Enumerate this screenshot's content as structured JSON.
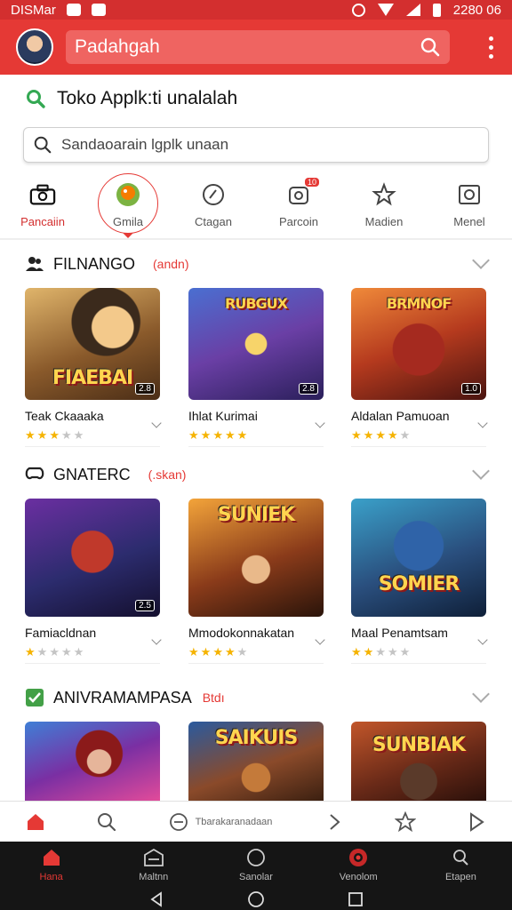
{
  "status_bar": {
    "left_text": "DISMar",
    "time": "2280 06"
  },
  "app_bar": {
    "search_value": "Padahgah"
  },
  "store": {
    "title": "Toko Applk:ti unalalah",
    "search_placeholder": "Sandaoarain lgplk unaan"
  },
  "categories": [
    {
      "label": "Pancaiin",
      "icon": "camera-bag-icon"
    },
    {
      "label": "Gmila",
      "icon": "game-avatar-icon"
    },
    {
      "label": "Ctagan",
      "icon": "compass-icon"
    },
    {
      "label": "Parcoin",
      "icon": "notification-icon",
      "badge": "10"
    },
    {
      "label": "Madien",
      "icon": "star-outline-icon"
    },
    {
      "label": "Menel",
      "icon": "image-icon"
    }
  ],
  "sections": [
    {
      "title": "FILNANGO",
      "subtitle": "(andn)",
      "icon": "people-icon",
      "apps": [
        {
          "name": "Teak Ckaaaka",
          "art_title": "FIAEBAI",
          "tag": "2.8",
          "rating": 3
        },
        {
          "name": "Ihlat Kurimai",
          "art_title": "RUBGUX",
          "tag": "2.8",
          "rating": 5
        },
        {
          "name": "Aldalan Pamuoan",
          "art_title": "BRMNOF",
          "tag": "1.0",
          "rating": 4
        }
      ]
    },
    {
      "title": "GNATERC",
      "subtitle": "(.skan)",
      "icon": "gamepad-icon",
      "apps": [
        {
          "name": "Famiacldnan",
          "art_title": "",
          "tag": "2.5",
          "rating": 1
        },
        {
          "name": "Mmodokonnakatan",
          "art_title": "SUNIEK",
          "tag": "",
          "rating": 4
        },
        {
          "name": "Maal Penamtsam",
          "art_title": "SOMIER",
          "tag": "",
          "rating": 2
        }
      ]
    },
    {
      "title": "ANIVRAMAMPASA",
      "subtitle": "Btdı",
      "icon": "check-icon",
      "apps": [
        {
          "name": "",
          "art_title": "",
          "tag": "",
          "rating": 0
        },
        {
          "name": "",
          "art_title": "SAIKUIS",
          "tag": "",
          "rating": 0
        },
        {
          "name": "",
          "art_title": "SUNBIAK",
          "tag": "",
          "rating": 0
        }
      ]
    }
  ],
  "bottom_toolbar": {
    "middle_text": "Tbarakaranadaan"
  },
  "bottom_nav": [
    {
      "label": "Hana",
      "icon": "store-icon"
    },
    {
      "label": "Maltnn",
      "icon": "games-icon"
    },
    {
      "label": "Sanolar",
      "icon": "search-circle-icon"
    },
    {
      "label": "Venolom",
      "icon": "apps-icon"
    },
    {
      "label": "Etapen",
      "icon": "account-icon"
    }
  ],
  "colors": {
    "accent": "#e53935",
    "star": "#f5b301",
    "nav_bg": "#151515"
  }
}
